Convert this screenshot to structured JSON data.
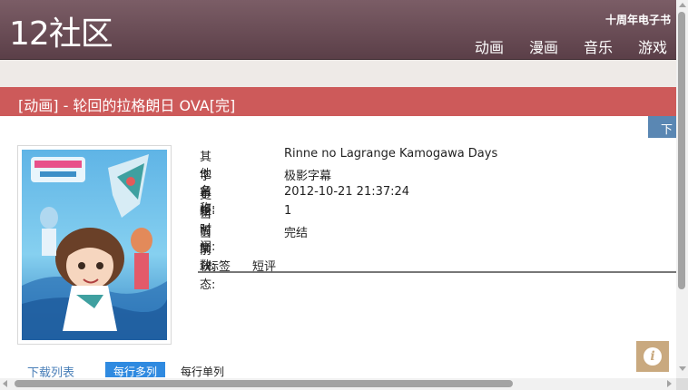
{
  "header": {
    "logo": "12社区",
    "ebook_link": "十周年电子书",
    "nav": [
      "动画",
      "漫画",
      "音乐",
      "游戏"
    ]
  },
  "title": "[动画] - 轮回的拉格朗日 OVA[完]",
  "download_tab": "下",
  "info": [
    {
      "key": "其他名称:",
      "value": "Rinne no Lagrange Kamogawa Days"
    },
    {
      "key": "字幕组:",
      "value": "极影字幕"
    },
    {
      "key": "更新时间:",
      "value": "2012-10-21 21:37:24"
    },
    {
      "key": "当前集数:",
      "value": "1"
    },
    {
      "key": "当前状态:",
      "value": "完结"
    }
  ],
  "tabs": [
    "标签",
    "短评"
  ],
  "download_list": {
    "label": "下载列表",
    "mode_multi": "每行多列",
    "mode_single": "每行单列"
  },
  "icons": {
    "info": "info-icon"
  },
  "colors": {
    "header": "#6a4e57",
    "title_bar": "#cd5a5a",
    "active_button": "#2f8ae0",
    "link": "#4a7fb8",
    "info_badge": "#c9a97f"
  }
}
